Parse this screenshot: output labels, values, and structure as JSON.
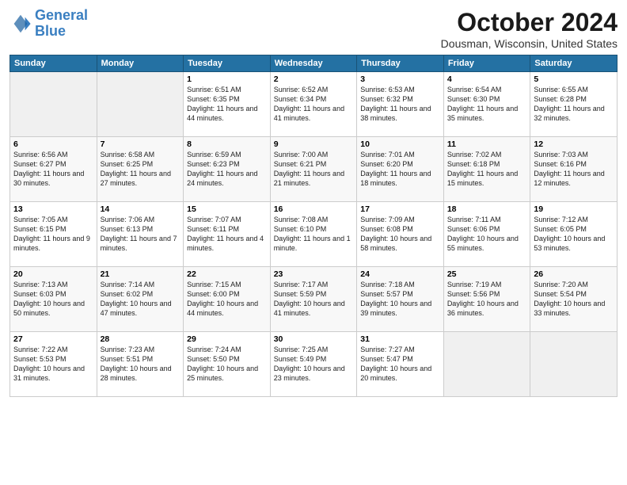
{
  "header": {
    "logo_line1": "General",
    "logo_line2": "Blue",
    "month": "October 2024",
    "location": "Dousman, Wisconsin, United States"
  },
  "weekdays": [
    "Sunday",
    "Monday",
    "Tuesday",
    "Wednesday",
    "Thursday",
    "Friday",
    "Saturday"
  ],
  "weeks": [
    [
      {
        "day": "",
        "info": ""
      },
      {
        "day": "",
        "info": ""
      },
      {
        "day": "1",
        "info": "Sunrise: 6:51 AM\nSunset: 6:35 PM\nDaylight: 11 hours and 44 minutes."
      },
      {
        "day": "2",
        "info": "Sunrise: 6:52 AM\nSunset: 6:34 PM\nDaylight: 11 hours and 41 minutes."
      },
      {
        "day": "3",
        "info": "Sunrise: 6:53 AM\nSunset: 6:32 PM\nDaylight: 11 hours and 38 minutes."
      },
      {
        "day": "4",
        "info": "Sunrise: 6:54 AM\nSunset: 6:30 PM\nDaylight: 11 hours and 35 minutes."
      },
      {
        "day": "5",
        "info": "Sunrise: 6:55 AM\nSunset: 6:28 PM\nDaylight: 11 hours and 32 minutes."
      }
    ],
    [
      {
        "day": "6",
        "info": "Sunrise: 6:56 AM\nSunset: 6:27 PM\nDaylight: 11 hours and 30 minutes."
      },
      {
        "day": "7",
        "info": "Sunrise: 6:58 AM\nSunset: 6:25 PM\nDaylight: 11 hours and 27 minutes."
      },
      {
        "day": "8",
        "info": "Sunrise: 6:59 AM\nSunset: 6:23 PM\nDaylight: 11 hours and 24 minutes."
      },
      {
        "day": "9",
        "info": "Sunrise: 7:00 AM\nSunset: 6:21 PM\nDaylight: 11 hours and 21 minutes."
      },
      {
        "day": "10",
        "info": "Sunrise: 7:01 AM\nSunset: 6:20 PM\nDaylight: 11 hours and 18 minutes."
      },
      {
        "day": "11",
        "info": "Sunrise: 7:02 AM\nSunset: 6:18 PM\nDaylight: 11 hours and 15 minutes."
      },
      {
        "day": "12",
        "info": "Sunrise: 7:03 AM\nSunset: 6:16 PM\nDaylight: 11 hours and 12 minutes."
      }
    ],
    [
      {
        "day": "13",
        "info": "Sunrise: 7:05 AM\nSunset: 6:15 PM\nDaylight: 11 hours and 9 minutes."
      },
      {
        "day": "14",
        "info": "Sunrise: 7:06 AM\nSunset: 6:13 PM\nDaylight: 11 hours and 7 minutes."
      },
      {
        "day": "15",
        "info": "Sunrise: 7:07 AM\nSunset: 6:11 PM\nDaylight: 11 hours and 4 minutes."
      },
      {
        "day": "16",
        "info": "Sunrise: 7:08 AM\nSunset: 6:10 PM\nDaylight: 11 hours and 1 minute."
      },
      {
        "day": "17",
        "info": "Sunrise: 7:09 AM\nSunset: 6:08 PM\nDaylight: 10 hours and 58 minutes."
      },
      {
        "day": "18",
        "info": "Sunrise: 7:11 AM\nSunset: 6:06 PM\nDaylight: 10 hours and 55 minutes."
      },
      {
        "day": "19",
        "info": "Sunrise: 7:12 AM\nSunset: 6:05 PM\nDaylight: 10 hours and 53 minutes."
      }
    ],
    [
      {
        "day": "20",
        "info": "Sunrise: 7:13 AM\nSunset: 6:03 PM\nDaylight: 10 hours and 50 minutes."
      },
      {
        "day": "21",
        "info": "Sunrise: 7:14 AM\nSunset: 6:02 PM\nDaylight: 10 hours and 47 minutes."
      },
      {
        "day": "22",
        "info": "Sunrise: 7:15 AM\nSunset: 6:00 PM\nDaylight: 10 hours and 44 minutes."
      },
      {
        "day": "23",
        "info": "Sunrise: 7:17 AM\nSunset: 5:59 PM\nDaylight: 10 hours and 41 minutes."
      },
      {
        "day": "24",
        "info": "Sunrise: 7:18 AM\nSunset: 5:57 PM\nDaylight: 10 hours and 39 minutes."
      },
      {
        "day": "25",
        "info": "Sunrise: 7:19 AM\nSunset: 5:56 PM\nDaylight: 10 hours and 36 minutes."
      },
      {
        "day": "26",
        "info": "Sunrise: 7:20 AM\nSunset: 5:54 PM\nDaylight: 10 hours and 33 minutes."
      }
    ],
    [
      {
        "day": "27",
        "info": "Sunrise: 7:22 AM\nSunset: 5:53 PM\nDaylight: 10 hours and 31 minutes."
      },
      {
        "day": "28",
        "info": "Sunrise: 7:23 AM\nSunset: 5:51 PM\nDaylight: 10 hours and 28 minutes."
      },
      {
        "day": "29",
        "info": "Sunrise: 7:24 AM\nSunset: 5:50 PM\nDaylight: 10 hours and 25 minutes."
      },
      {
        "day": "30",
        "info": "Sunrise: 7:25 AM\nSunset: 5:49 PM\nDaylight: 10 hours and 23 minutes."
      },
      {
        "day": "31",
        "info": "Sunrise: 7:27 AM\nSunset: 5:47 PM\nDaylight: 10 hours and 20 minutes."
      },
      {
        "day": "",
        "info": ""
      },
      {
        "day": "",
        "info": ""
      }
    ]
  ]
}
